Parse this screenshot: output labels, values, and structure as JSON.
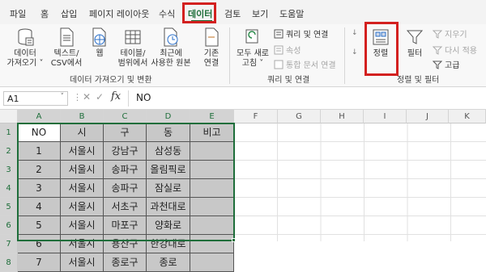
{
  "tabs": [
    "파일",
    "홈",
    "삽입",
    "페이지 레이아웃",
    "수식",
    "데이터",
    "검토",
    "보기",
    "도움말"
  ],
  "ribbon": {
    "get_data": "데이터\n가져오기 ˅",
    "text_csv": "텍스트/\nCSV에서",
    "web": "웹",
    "table_range": "테이블/\n범위에서",
    "recent_sources": "최근에\n사용한 원본",
    "existing": "기존\n연결",
    "group1_label": "데이터 가져오기 및 변환",
    "refresh_all": "모두 새로\n고침 ˅",
    "queries_connections": "쿼리 및 연결",
    "properties": "속성",
    "edit_links": "통합 문서 연결",
    "group2_label": "쿼리 및 연결",
    "sort": "정렬",
    "filter": "필터",
    "clear": "지우기",
    "reapply": "다시 적용",
    "advanced": "고급",
    "group3_label": "정렬 및 필터"
  },
  "formula": {
    "namebox": "A1",
    "value": "NO"
  },
  "columns": [
    "A",
    "B",
    "C",
    "D",
    "E",
    "F",
    "G",
    "H",
    "I",
    "J",
    "K"
  ],
  "rows": [
    "1",
    "2",
    "3",
    "4",
    "5",
    "6",
    "7",
    "8"
  ],
  "table": [
    [
      "NO",
      "시",
      "구",
      "동",
      "비고"
    ],
    [
      "1",
      "서울시",
      "강남구",
      "삼성동",
      ""
    ],
    [
      "2",
      "서울시",
      "송파구",
      "올림픽로",
      ""
    ],
    [
      "3",
      "서울시",
      "송파구",
      "잠실로",
      ""
    ],
    [
      "4",
      "서울시",
      "서초구",
      "과천대로",
      ""
    ],
    [
      "5",
      "서울시",
      "마포구",
      "양화로",
      ""
    ],
    [
      "6",
      "서울시",
      "용산구",
      "한강대로",
      ""
    ],
    [
      "7",
      "서울시",
      "종로구",
      "종로",
      ""
    ]
  ],
  "colors": {
    "accent": "#1e6e3a",
    "highlight": "#d3201f",
    "cell_fill": "#c8c8c8"
  }
}
